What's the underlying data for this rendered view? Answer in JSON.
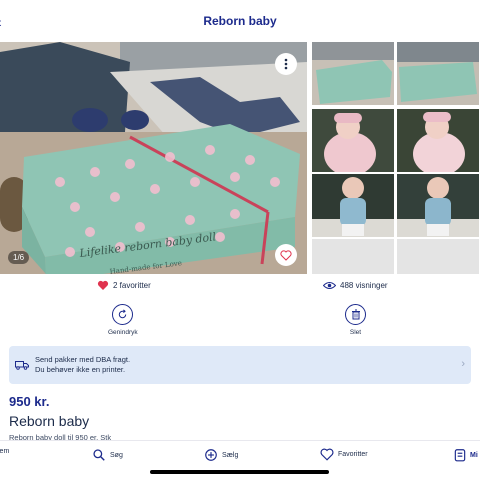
{
  "header": {
    "title": "Reborn baby"
  },
  "gallery": {
    "counter": "1/6"
  },
  "stats": {
    "favorites": "2 favoritter",
    "views": "488 visninger"
  },
  "actions": {
    "repost_label": "Genindryk",
    "delete_label": "Slet"
  },
  "shipping_banner": {
    "line1": "Send pakker med DBA fragt.",
    "line2": "Du behøver ikke en printer."
  },
  "listing": {
    "price": "950 kr.",
    "title": "Reborn baby",
    "description": "Reborn baby doll til 950 er. Stk"
  },
  "bottom_nav": {
    "home": "jem",
    "search": "Søg",
    "sell": "Sælg",
    "favorites": "Favoritter",
    "my": "Mi"
  },
  "colors": {
    "brand": "#1c2a8c",
    "heart": "#e0344f",
    "banner_bg": "#dfe9f8"
  }
}
